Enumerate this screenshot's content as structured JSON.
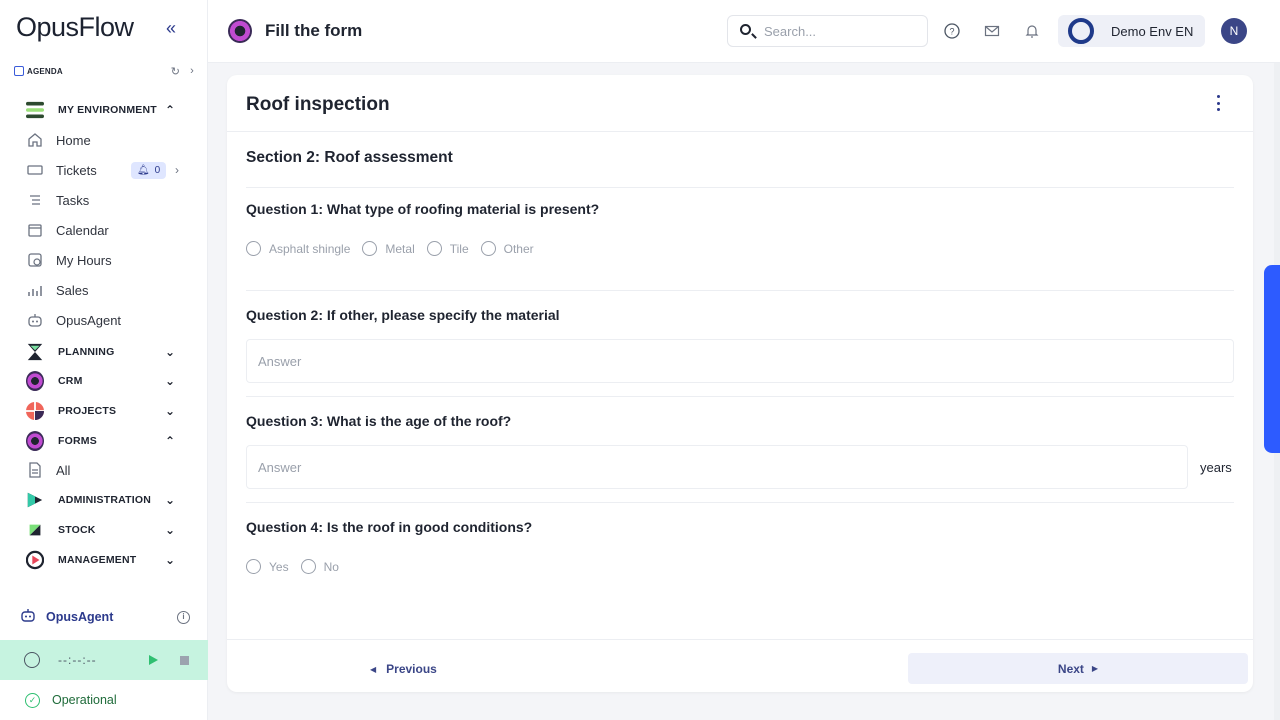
{
  "app": {
    "logo": "OpusFlow",
    "collapse_icon": "double-chevron-left-icon"
  },
  "agenda": {
    "label": "AGENDA"
  },
  "nav": {
    "my_environment": "MY ENVIRONMENT",
    "home": "Home",
    "tickets": "Tickets",
    "tickets_count": "0",
    "tasks": "Tasks",
    "calendar": "Calendar",
    "my_hours": "My Hours",
    "sales": "Sales",
    "opusagent": "OpusAgent",
    "planning": "PLANNING",
    "crm": "CRM",
    "projects": "PROJECTS",
    "forms": "FORMS",
    "all": "All",
    "administration": "ADMINISTRATION",
    "stock": "STOCK",
    "management": "MANAGEMENT"
  },
  "sidebar_footer": {
    "agent_label": "OpusAgent",
    "timer": "--:--:--",
    "status": "Operational",
    "status_color": "#2fbf71"
  },
  "header": {
    "title": "Fill the form",
    "search_placeholder": "Search...",
    "environment": "Demo Env EN",
    "avatar_initial": "N"
  },
  "form": {
    "title": "Roof inspection",
    "section": "Section 2: Roof assessment",
    "q1": "Question 1: What type of roofing material is present?",
    "q1_options": [
      "Asphalt shingle",
      "Metal",
      "Tile",
      "Other"
    ],
    "q2": "Question 2: If other, please specify the material",
    "q2_placeholder": "Answer",
    "q3": "Question 3: What is the age of the roof?",
    "q3_placeholder": "Answer",
    "q3_unit": "years",
    "q4": "Question 4: Is the roof in good conditions?",
    "q4_options": [
      "Yes",
      "No"
    ],
    "prev_label": "Previous",
    "next_label": "Next"
  },
  "colors": {
    "accent": "#3b4687",
    "brand_blue": "#2d5bff",
    "timer_bg": "#c6f3e0"
  }
}
